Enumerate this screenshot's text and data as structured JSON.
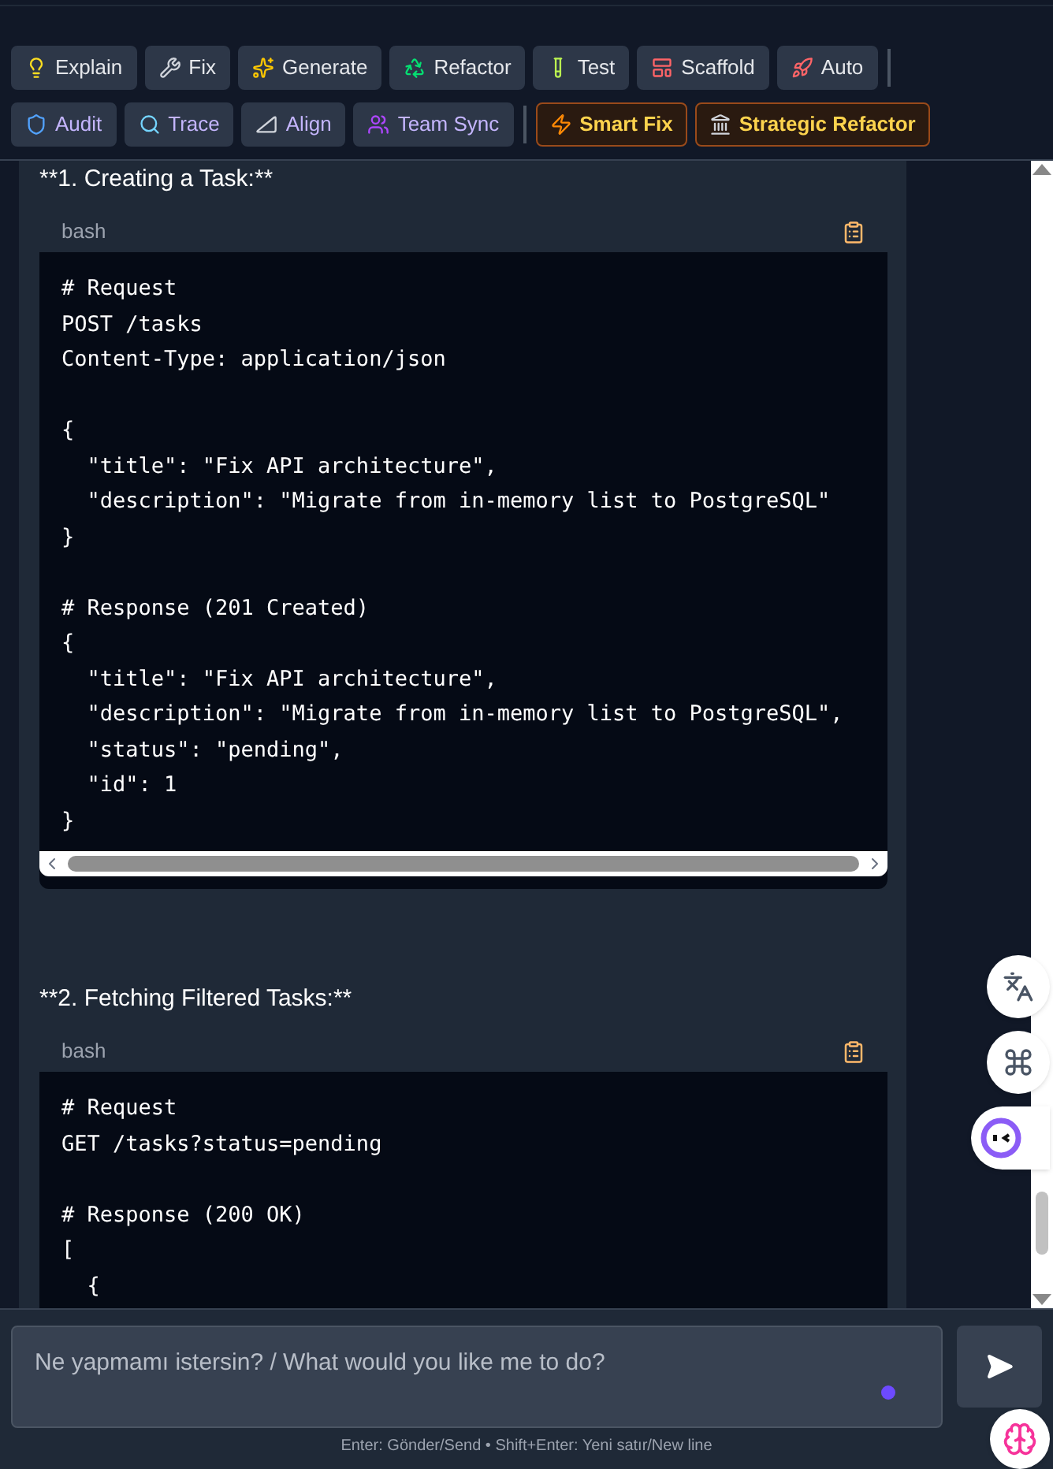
{
  "toolbar": [
    {
      "label": "Explain",
      "kind": "normal"
    },
    {
      "label": "Fix",
      "kind": "normal"
    },
    {
      "label": "Generate",
      "kind": "normal"
    },
    {
      "label": "Refactor",
      "kind": "normal"
    },
    {
      "label": "Test",
      "kind": "normal"
    },
    {
      "label": "Scaffold",
      "kind": "normal"
    },
    {
      "label": "Auto",
      "kind": "normal"
    },
    {
      "kind": "separator"
    },
    {
      "label": "Audit",
      "kind": "accent"
    },
    {
      "label": "Trace",
      "kind": "accent"
    },
    {
      "label": "Align",
      "kind": "accent"
    },
    {
      "label": "Team Sync",
      "kind": "accent"
    },
    {
      "kind": "separator"
    },
    {
      "label": "Smart Fix",
      "kind": "strategic"
    },
    {
      "label": "Strategic Refactor",
      "kind": "strategic"
    }
  ],
  "sections": [
    {
      "heading": "**1. Creating a Task:**",
      "code": {
        "language": "bash",
        "horizontal_scrollbar": true,
        "lines": [
          {
            "text": "# Request",
            "blank_before": false
          },
          {
            "text": "POST /tasks",
            "blank_before": false
          },
          {
            "text": "Content-Type: application/json",
            "blank_before": false
          },
          {
            "text": "{",
            "blank_before": true
          },
          {
            "text": "  \"title\": \"Fix API architecture\",",
            "blank_before": false
          },
          {
            "text": "  \"description\": \"Migrate from in-memory list to PostgreSQL\"",
            "blank_before": false
          },
          {
            "text": "}",
            "blank_before": false
          },
          {
            "text": "# Response (201 Created)",
            "blank_before": true
          },
          {
            "text": "{",
            "blank_before": false
          },
          {
            "text": "  \"title\": \"Fix API architecture\",",
            "blank_before": false
          },
          {
            "text": "  \"description\": \"Migrate from in-memory list to PostgreSQL\",",
            "blank_before": false
          },
          {
            "text": "  \"status\": \"pending\",",
            "blank_before": false
          },
          {
            "text": "  \"id\": 1",
            "blank_before": false
          },
          {
            "text": "}",
            "blank_before": false
          }
        ]
      }
    },
    {
      "heading": "**2. Fetching Filtered Tasks:**",
      "code": {
        "language": "bash",
        "horizontal_scrollbar": false,
        "lines": [
          {
            "text": "# Request",
            "blank_before": false
          },
          {
            "text": "GET /tasks?status=pending",
            "blank_before": false
          },
          {
            "text": "# Response (200 OK)",
            "blank_before": true
          },
          {
            "text": "[",
            "blank_before": false
          },
          {
            "text": "  {",
            "blank_before": false
          }
        ]
      }
    }
  ],
  "input": {
    "placeholder": "Ne yapmamı istersin? / What would you like me to do?"
  },
  "hint": "Enter: Gönder/Send • Shift+Enter: Yeni satır/New line"
}
